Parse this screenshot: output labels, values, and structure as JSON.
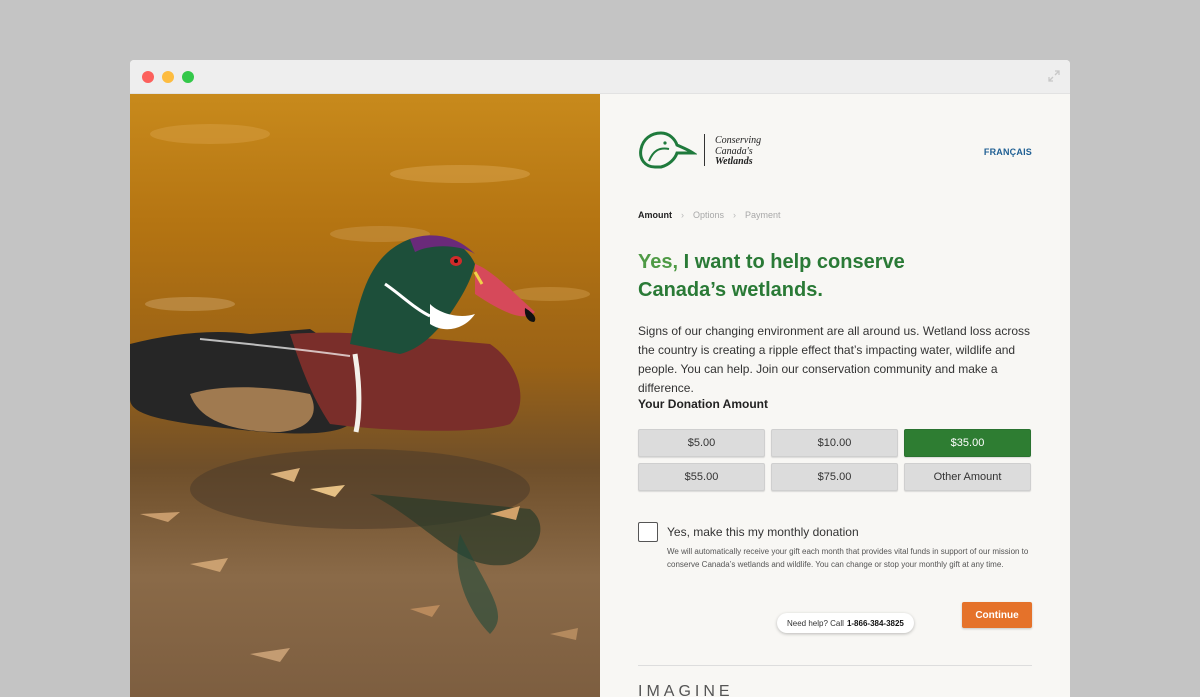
{
  "brand": {
    "logo_lines": [
      "Conserving",
      "Canada's",
      "Wetlands"
    ],
    "accent_green": "#2e7d32",
    "accent_orange": "#e5722a"
  },
  "header": {
    "language_link": "FRANÇAIS"
  },
  "steps": [
    {
      "label": "Amount",
      "active": true
    },
    {
      "label": "Options",
      "active": false
    },
    {
      "label": "Payment",
      "active": false
    }
  ],
  "hero": {
    "headline": "Yes, I want to help conserve Canada’s wetlands.",
    "description": "Signs of our changing environment are all around us. Wetland loss across the country is creating a ripple effect that’s impacting water, wildlife and people. You can help. Join our conservation community and make a difference."
  },
  "donation": {
    "section_label": "Your Donation Amount",
    "amounts": [
      {
        "label": "$5.00",
        "selected": false
      },
      {
        "label": "$10.00",
        "selected": false
      },
      {
        "label": "$35.00",
        "selected": true
      },
      {
        "label": "$55.00",
        "selected": false
      },
      {
        "label": "$75.00",
        "selected": false
      },
      {
        "label": "Other Amount",
        "selected": false
      }
    ],
    "monthly_label": "Yes, make this my monthly donation",
    "monthly_checked": false,
    "monthly_note": "We will automatically receive your gift each month that provides vital funds in support of our mission to conserve Canada’s wetlands and wildlife. You can change or stop your monthly gift at any time.",
    "continue_label": "Continue"
  },
  "footer": {
    "imagine_text": "IMAGINE"
  },
  "help": {
    "prefix": "Need help? Call",
    "phone": "1-866-384-3825"
  }
}
